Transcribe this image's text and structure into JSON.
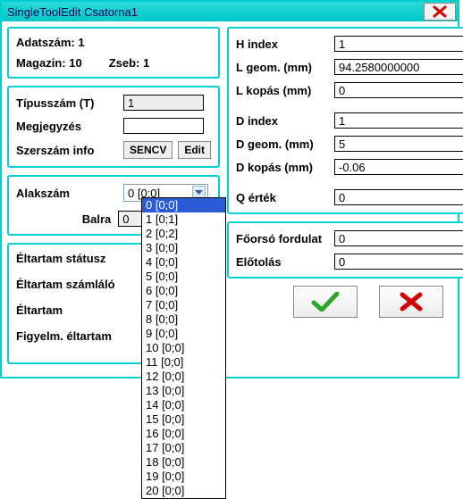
{
  "window": {
    "title": "SingleToolEdit Csatorna1"
  },
  "top": {
    "adatszam_label": "Adatszám: 1",
    "magazin_label": "Magazin: 10",
    "zseb_label": "Zseb: 1"
  },
  "type": {
    "tipusszam_label": "Típusszám (T)",
    "tipusszam_value": "1",
    "megjegyzes_label": "Megjegyzés",
    "megjegyzes_value": "",
    "szerszam_info_label": "Szerszám info",
    "sencv_btn": "SENCV",
    "edit_btn": "Edit"
  },
  "shape": {
    "alakszam_label": "Alakszám",
    "combo_value": "0 [0;0]",
    "balra_label": "Balra",
    "balra_value": "0",
    "options": [
      "0 [0;0]",
      "1 [0;1]",
      "2 [0;2]",
      "3 [0;0]",
      "4 [0;0]",
      "5 [0;0]",
      "6 [0;0]",
      "7 [0;0]",
      "8 [0;0]",
      "9 [0;0]",
      "10 [0;0]",
      "11 [0;0]",
      "12 [0;0]",
      "13 [0;0]",
      "14 [0;0]",
      "15 [0;0]",
      "16 [0;0]",
      "17 [0;0]",
      "18 [0;0]",
      "19 [0;0]",
      "20 [0;0]"
    ]
  },
  "life": {
    "status_label": "Éltartam státusz",
    "szamlalo_label": "Éltartam számláló",
    "eltartam_label": "Éltartam",
    "figyelm_label": "Figyelm. éltartam"
  },
  "geom": {
    "h_index_label": "H index",
    "h_index_value": "1",
    "l_geom_label": "L geom. (mm)",
    "l_geom_value": "94.2580000000",
    "l_kopas_label": "L kopás (mm)",
    "l_kopas_value": "0",
    "d_index_label": "D index",
    "d_index_value": "1",
    "d_geom_label": "D geom. (mm)",
    "d_geom_value": "5",
    "d_kopas_label": "D kopás (mm)",
    "d_kopas_value": "-0.06",
    "q_ertek_label": "Q érték",
    "q_ertek_value": "0"
  },
  "spindle": {
    "fordulat_label": "Főorsó fordulat",
    "fordulat_value": "0",
    "elotolas_label": "Előtolás",
    "elotolas_value": "0"
  },
  "icons": {
    "close": "close-icon",
    "chevron_down": "chevron-down-icon",
    "ok": "check-icon",
    "cancel": "x-icon"
  }
}
